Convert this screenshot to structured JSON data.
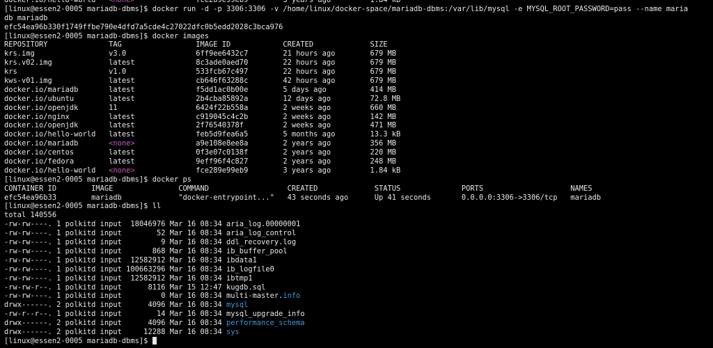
{
  "colors": {
    "background": "#000000",
    "text": "#e6e6e6",
    "directory": "#3a9ad9",
    "none_tag": "#c658c6"
  },
  "terminal": {
    "lines": [
      [
        {
          "t": "docker.io/hello-world   "
        },
        {
          "t": "<none>",
          "c": "magenta"
        },
        {
          "t": "              fce289e99eb9        3 years ago         1.84 kB"
        }
      ],
      [
        {
          "t": "[linux@essen2-0005 mariadb-dbms]$ docker run -d -p 3306:3306 -v /home/linux/docker-space/mariadb-dbms:/var/lib/mysql -e MYSQL_ROOT_PASSWORD=pass --name maria"
        }
      ],
      [
        {
          "t": "db mariadb"
        }
      ],
      [
        {
          "t": "efc54ea96b330f1749ffbe790e4dfd7a5cde4c27022dfc0b5edd2028c3bca976"
        }
      ],
      [
        {
          "t": "[linux@essen2-0005 mariadb-dbms]$ docker images"
        }
      ],
      [
        {
          "t": "REPOSITORY              TAG                 IMAGE ID            CREATED             SIZE"
        }
      ],
      [
        {
          "t": "krs.img                 v3.0                6ff9ee6432c7        21 hours ago        679 MB"
        }
      ],
      [
        {
          "t": "krs.v02.img             latest              8c3ade0aed70        22 hours ago        679 MB"
        }
      ],
      [
        {
          "t": "krs                     v1.0                533fcb67c497        22 hours ago        679 MB"
        }
      ],
      [
        {
          "t": "kws-v01.img             latest              cb646f63288c        42 hours ago        679 MB"
        }
      ],
      [
        {
          "t": "docker.io/mariadb       latest              f5dd1ac0b00e        5 days ago          414 MB"
        }
      ],
      [
        {
          "t": "docker.io/ubuntu        latest              2b4cba85892a        12 days ago         72.8 MB"
        }
      ],
      [
        {
          "t": "docker.io/openjdk       11                  6424f22b558a        2 weeks ago         660 MB"
        }
      ],
      [
        {
          "t": "docker.io/nginx         latest              c919045c4c2b        2 weeks ago         142 MB"
        }
      ],
      [
        {
          "t": "docker.io/openjdk       latest              2f76540378f         2 weeks ago         471 MB"
        }
      ],
      [
        {
          "t": "docker.io/hello-world   latest              feb5d9fea6a5        5 months ago        13.3 kB"
        }
      ],
      [
        {
          "t": "docker.io/mariadb       "
        },
        {
          "t": "<none>",
          "c": "magenta"
        },
        {
          "t": "              a9e108e8ee8a        2 years ago         356 MB"
        }
      ],
      [
        {
          "t": "docker.io/centos        latest              0f3e07c0138f        2 years ago         220 MB"
        }
      ],
      [
        {
          "t": "docker.io/fedora        latest              9eff96f4c827        2 years ago         248 MB"
        }
      ],
      [
        {
          "t": "docker.io/hello-world   "
        },
        {
          "t": "<none>",
          "c": "magenta"
        },
        {
          "t": "              fce289e99eb9        3 years ago         1.84 kB"
        }
      ],
      [
        {
          "t": "[linux@essen2-0005 mariadb-dbms]$ docker ps"
        }
      ],
      [
        {
          "t": "CONTAINER ID        IMAGE               COMMAND                  CREATED             STATUS              PORTS                    NAMES"
        }
      ],
      [
        {
          "t": "efc54ea96b33        mariadb             \"docker-entrypoint...\"   43 seconds ago      Up 41 seconds       0.0.0.0:3306->3306/tcp   mariadb"
        }
      ],
      [
        {
          "t": "[linux@essen2-0005 mariadb-dbms]$ ll"
        }
      ],
      [
        {
          "t": "total 140556"
        }
      ],
      [
        {
          "t": "-rw-rw----. 1 polkitd input  18046976 Mar 16 08:34 aria_log.00000001"
        }
      ],
      [
        {
          "t": "-rw-rw----. 1 polkitd input        52 Mar 16 08:34 aria_log_control"
        }
      ],
      [
        {
          "t": "-rw-rw----. 1 polkitd input         9 Mar 16 08:34 ddl_recovery.log"
        }
      ],
      [
        {
          "t": "-rw-rw----. 1 polkitd input       868 Mar 16 08:34 ib_buffer_pool"
        }
      ],
      [
        {
          "t": "-rw-rw----. 1 polkitd input  12582912 Mar 16 08:34 ibdata1"
        }
      ],
      [
        {
          "t": "-rw-rw----. 1 polkitd input 100663296 Mar 16 08:34 ib_logfile0"
        }
      ],
      [
        {
          "t": "-rw-rw----. 1 polkitd input  12582912 Mar 16 08:34 ibtmp1"
        }
      ],
      [
        {
          "t": "-rw-rw-r--. 1 polkitd input      8116 Mar 15 12:47 kugdb.sql"
        }
      ],
      [
        {
          "t": "-rw-rw----. 1 polkitd input         0 Mar 16 08:34 multi-master."
        },
        {
          "t": "info",
          "c": "blue"
        }
      ],
      [
        {
          "t": "drwx------. 2 polkitd input      4096 Mar 16 08:34 "
        },
        {
          "t": "mysql",
          "c": "blue"
        }
      ],
      [
        {
          "t": "-rw-r--r--. 1 polkitd input        14 Mar 16 08:34 mysql_upgrade_info"
        }
      ],
      [
        {
          "t": "drwx------. 2 polkitd input      4096 Mar 16 08:34 "
        },
        {
          "t": "performance_schema",
          "c": "blue"
        }
      ],
      [
        {
          "t": "drwx------. 2 polkitd input     12288 Mar 16 08:34 "
        },
        {
          "t": "sys",
          "c": "blue"
        }
      ],
      [
        {
          "t": "[linux@essen2-0005 mariadb-dbms]$ "
        }
      ]
    ],
    "cursor_line": 38
  }
}
